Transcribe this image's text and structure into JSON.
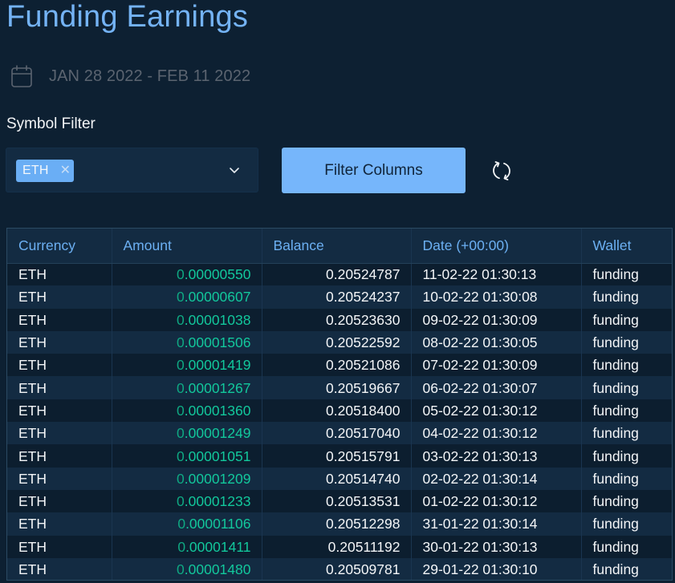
{
  "header": {
    "title": "Funding Earnings",
    "date_range": "JAN 28 2022 - FEB 11 2022",
    "calendar_icon": "calendar-icon"
  },
  "filter": {
    "label": "Symbol Filter",
    "selected_chips": [
      {
        "label": "ETH",
        "remove_icon": "close-icon"
      }
    ],
    "dropdown_icon": "chevron-down-icon",
    "filter_button_label": "Filter Columns",
    "refresh_icon": "refresh-icon"
  },
  "colors": {
    "title": "#74b3f5",
    "accent_button": "#76b6fb",
    "amount_positive": "#12c89c",
    "header_text": "#6cb0f3",
    "background": "#0d2032"
  },
  "table": {
    "columns": [
      "Currency",
      "Amount",
      "Balance",
      "Date (+00:00)",
      "Wallet"
    ],
    "rows": [
      {
        "currency": "ETH",
        "amount": "0.00000550",
        "balance": "0.20524787",
        "date": "11-02-22 01:30:13",
        "wallet": "funding"
      },
      {
        "currency": "ETH",
        "amount": "0.00000607",
        "balance": "0.20524237",
        "date": "10-02-22 01:30:08",
        "wallet": "funding"
      },
      {
        "currency": "ETH",
        "amount": "0.00001038",
        "balance": "0.20523630",
        "date": "09-02-22 01:30:09",
        "wallet": "funding"
      },
      {
        "currency": "ETH",
        "amount": "0.00001506",
        "balance": "0.20522592",
        "date": "08-02-22 01:30:05",
        "wallet": "funding"
      },
      {
        "currency": "ETH",
        "amount": "0.00001419",
        "balance": "0.20521086",
        "date": "07-02-22 01:30:09",
        "wallet": "funding"
      },
      {
        "currency": "ETH",
        "amount": "0.00001267",
        "balance": "0.20519667",
        "date": "06-02-22 01:30:07",
        "wallet": "funding"
      },
      {
        "currency": "ETH",
        "amount": "0.00001360",
        "balance": "0.20518400",
        "date": "05-02-22 01:30:12",
        "wallet": "funding"
      },
      {
        "currency": "ETH",
        "amount": "0.00001249",
        "balance": "0.20517040",
        "date": "04-02-22 01:30:12",
        "wallet": "funding"
      },
      {
        "currency": "ETH",
        "amount": "0.00001051",
        "balance": "0.20515791",
        "date": "03-02-22 01:30:13",
        "wallet": "funding"
      },
      {
        "currency": "ETH",
        "amount": "0.00001209",
        "balance": "0.20514740",
        "date": "02-02-22 01:30:14",
        "wallet": "funding"
      },
      {
        "currency": "ETH",
        "amount": "0.00001233",
        "balance": "0.20513531",
        "date": "01-02-22 01:30:12",
        "wallet": "funding"
      },
      {
        "currency": "ETH",
        "amount": "0.00001106",
        "balance": "0.20512298",
        "date": "31-01-22 01:30:14",
        "wallet": "funding"
      },
      {
        "currency": "ETH",
        "amount": "0.00001411",
        "balance": "0.20511192",
        "date": "30-01-22 01:30:13",
        "wallet": "funding"
      },
      {
        "currency": "ETH",
        "amount": "0.00001480",
        "balance": "0.20509781",
        "date": "29-01-22 01:30:10",
        "wallet": "funding"
      }
    ]
  }
}
